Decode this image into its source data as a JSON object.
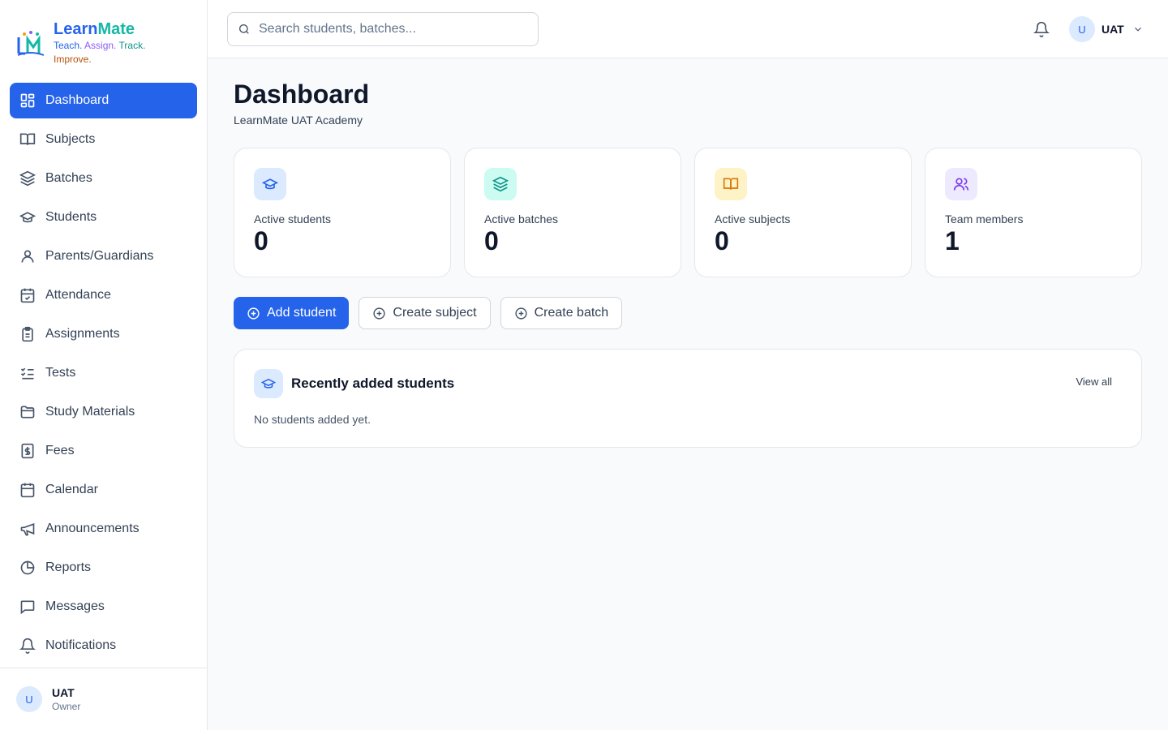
{
  "brand": {
    "name_part1": "Learn",
    "name_part2": "Mate",
    "tagline": [
      "Teach.",
      "Assign.",
      "Track.",
      "Improve."
    ]
  },
  "sidebar": {
    "items": [
      {
        "label": "Dashboard",
        "icon": "dashboard-icon",
        "active": true
      },
      {
        "label": "Subjects",
        "icon": "book-icon"
      },
      {
        "label": "Batches",
        "icon": "layers-icon"
      },
      {
        "label": "Students",
        "icon": "graduation-cap-icon"
      },
      {
        "label": "Parents/Guardians",
        "icon": "user-icon"
      },
      {
        "label": "Attendance",
        "icon": "calendar-check-icon"
      },
      {
        "label": "Assignments",
        "icon": "clipboard-icon"
      },
      {
        "label": "Tests",
        "icon": "list-check-icon"
      },
      {
        "label": "Study Materials",
        "icon": "folder-icon"
      },
      {
        "label": "Fees",
        "icon": "dollar-icon"
      },
      {
        "label": "Calendar",
        "icon": "calendar-icon"
      },
      {
        "label": "Announcements",
        "icon": "megaphone-icon"
      },
      {
        "label": "Reports",
        "icon": "pie-chart-icon"
      },
      {
        "label": "Messages",
        "icon": "message-icon"
      },
      {
        "label": "Notifications",
        "icon": "bell-icon"
      }
    ],
    "footer": {
      "avatar_initial": "U",
      "name": "UAT",
      "role": "Owner"
    }
  },
  "header": {
    "search_placeholder": "Search students, batches...",
    "user_initial": "U",
    "user_name": "UAT"
  },
  "main": {
    "title": "Dashboard",
    "subtitle": "LearnMate UAT Academy",
    "stats": [
      {
        "label": "Active students",
        "value": "0",
        "icon": "graduation-cap-icon",
        "bg": "#dbeafe",
        "color": "#2563eb"
      },
      {
        "label": "Active batches",
        "value": "0",
        "icon": "layers-icon",
        "bg": "#ccfbf1",
        "color": "#0d9488"
      },
      {
        "label": "Active subjects",
        "value": "0",
        "icon": "book-icon",
        "bg": "#fef3c7",
        "color": "#d97706"
      },
      {
        "label": "Team members",
        "value": "1",
        "icon": "users-icon",
        "bg": "#ede9fe",
        "color": "#7c3aed"
      }
    ],
    "actions": {
      "add_student": "Add student",
      "create_subject": "Create subject",
      "create_batch": "Create batch"
    },
    "recent": {
      "title": "Recently added students",
      "view_all": "View all",
      "empty": "No students added yet."
    }
  },
  "colors": {
    "accent": "#2563eb",
    "brand_teal": "#14b8a6"
  }
}
